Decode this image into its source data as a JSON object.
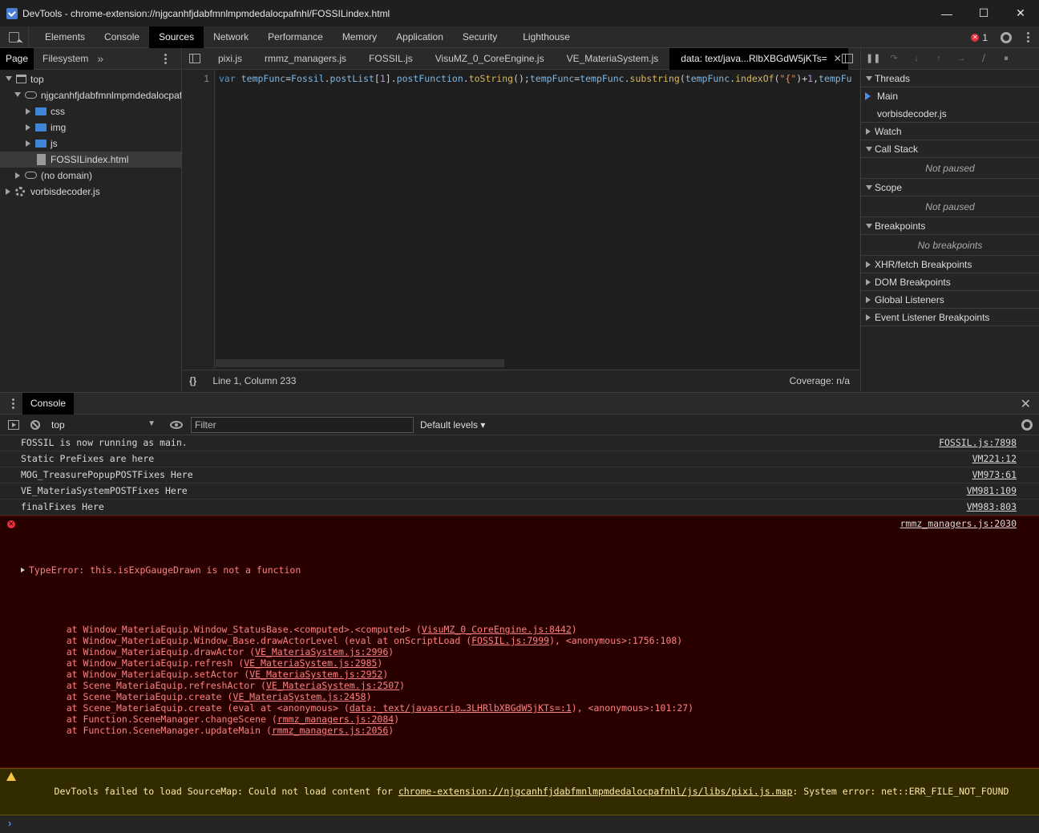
{
  "window": {
    "title": "DevTools - chrome-extension://njgcanhfjdabfmnlmpmdedalocpafnhl/FOSSILindex.html",
    "minimize": "—",
    "maximize": "☐",
    "close": "✕"
  },
  "main_tabs": [
    "Elements",
    "Console",
    "Sources",
    "Network",
    "Performance",
    "Memory",
    "Application",
    "Security",
    "Lighthouse"
  ],
  "active_main_tab": "Sources",
  "error_count": "1",
  "navigator": {
    "tabs": [
      "Page",
      "Filesystem"
    ],
    "more": "»",
    "tree": [
      {
        "label": "top",
        "icon": "frame-icon"
      },
      {
        "label": "njgcanhfjdabfmnlmpmdedalocpafnhl",
        "icon": "cloud-icon"
      },
      {
        "label": "css",
        "icon": "folder-icon"
      },
      {
        "label": "img",
        "icon": "folder-icon"
      },
      {
        "label": "js",
        "icon": "folder-icon"
      },
      {
        "label": "FOSSILindex.html",
        "icon": "file-icon"
      },
      {
        "label": "(no domain)",
        "icon": "cloud-icon"
      },
      {
        "label": "vorbisdecoder.js",
        "icon": "gear-icon"
      }
    ]
  },
  "editor": {
    "tabs": [
      "pixi.js",
      "rmmz_managers.js",
      "FOSSIL.js",
      "VisuMZ_0_CoreEngine.js",
      "VE_MateriaSystem.js",
      "data: text/java...RlbXBGdW5jKTs="
    ],
    "active_tab": "data: text/java...RlbXBGdW5jKTs=",
    "line_number": "1",
    "code": "var tempFunc=Fossil.postList[1].postFunction.toString();tempFunc=tempFunc.substring(tempFunc.indexOf(\"{\")+1,tempFu",
    "status_braces": "{}",
    "cursor": "Line 1, Column 233",
    "coverage": "Coverage: n/a"
  },
  "debugger": {
    "sections": {
      "threads": "Threads",
      "watch": "Watch",
      "call_stack": "Call Stack",
      "scope": "Scope",
      "breakpoints": "Breakpoints",
      "xhr": "XHR/fetch Breakpoints",
      "dom": "DOM Breakpoints",
      "global": "Global Listeners",
      "event": "Event Listener Breakpoints"
    },
    "threads": [
      "Main",
      "vorbisdecoder.js"
    ],
    "not_paused": "Not paused",
    "no_breakpoints": "No breakpoints"
  },
  "console": {
    "tab": "Console",
    "context": "top",
    "filter_placeholder": "Filter",
    "levels": "Default levels ▾",
    "messages": [
      {
        "text": "FOSSIL is now running as main.",
        "source": "FOSSIL.js:7898"
      },
      {
        "text": "Static PreFixes are here",
        "source": "VM221:12"
      },
      {
        "text": "MOG_TreasurePopupPOSTFixes Here",
        "source": "VM973:61"
      },
      {
        "text": "VE_MateriaSystemPOSTFixes Here",
        "source": "VM981:109"
      },
      {
        "text": "finalFixes Here",
        "source": "VM983:803"
      }
    ],
    "error": {
      "head": "TypeError: this.isExpGaugeDrawn is not a function",
      "source": "rmmz_managers.js:2030",
      "stack": [
        {
          "pre": "    at Window_MateriaEquip.Window_StatusBase.<computed>.<computed> (",
          "link": "VisuMZ_0_CoreEngine.js:8442",
          "post": ")"
        },
        {
          "pre": "    at Window_MateriaEquip.Window_Base.drawActorLevel (eval at onScriptLoad (",
          "link": "FOSSIL.js:7999",
          "post": "), <anonymous>:1756:108)"
        },
        {
          "pre": "    at Window_MateriaEquip.drawActor (",
          "link": "VE_MateriaSystem.js:2996",
          "post": ")"
        },
        {
          "pre": "    at Window_MateriaEquip.refresh (",
          "link": "VE_MateriaSystem.js:2985",
          "post": ")"
        },
        {
          "pre": "    at Window_MateriaEquip.setActor (",
          "link": "VE_MateriaSystem.js:2952",
          "post": ")"
        },
        {
          "pre": "    at Scene_MateriaEquip.refreshActor (",
          "link": "VE_MateriaSystem.js:2507",
          "post": ")"
        },
        {
          "pre": "    at Scene_MateriaEquip.create (",
          "link": "VE_MateriaSystem.js:2458",
          "post": ")"
        },
        {
          "pre": "    at Scene_MateriaEquip.create (eval at <anonymous> (",
          "link": "data:_text/javascrip…3LHRlbXBGdW5jKTs=:1",
          "post": "), <anonymous>:101:27)"
        },
        {
          "pre": "    at Function.SceneManager.changeScene (",
          "link": "rmmz_managers.js:2084",
          "post": ")"
        },
        {
          "pre": "    at Function.SceneManager.updateMain (",
          "link": "rmmz_managers.js:2056",
          "post": ")"
        }
      ]
    },
    "warning": {
      "pre": "DevTools failed to load SourceMap: Could not load content for ",
      "link": "chrome-extension://njgcanhfjdabfmnlmpmdedalocpafnhl/js/libs/pixi.js.map",
      "post": ": System error: net::ERR_FILE_NOT_FOUND"
    },
    "prompt": "›"
  }
}
